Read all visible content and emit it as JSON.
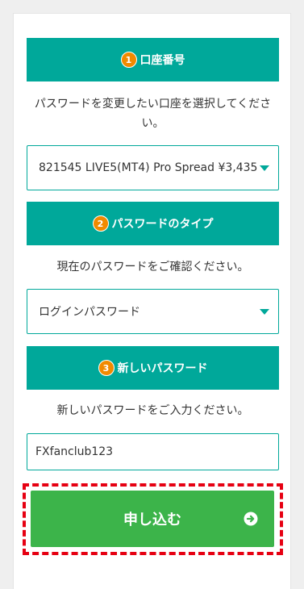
{
  "sections": [
    {
      "number": "1",
      "title": "口座番号",
      "description": "パスワードを変更したい口座を選択してください。",
      "field_value": "821545 LIVE5(MT4) Pro Spread ¥3,435"
    },
    {
      "number": "2",
      "title": "パスワードのタイプ",
      "description": "現在のパスワードをご確認ください。",
      "field_value": "ログインパスワード"
    },
    {
      "number": "3",
      "title": "新しいパスワード",
      "description": "新しいパスワードをご入力ください。",
      "field_value": "FXfanclub123"
    }
  ],
  "submit": {
    "label": "申し込む",
    "icon": "arrow-right-circle-icon"
  },
  "colors": {
    "header": "#00a89a",
    "badge": "#f08a00",
    "submit": "#3cb44a",
    "highlight": "#e60012"
  }
}
